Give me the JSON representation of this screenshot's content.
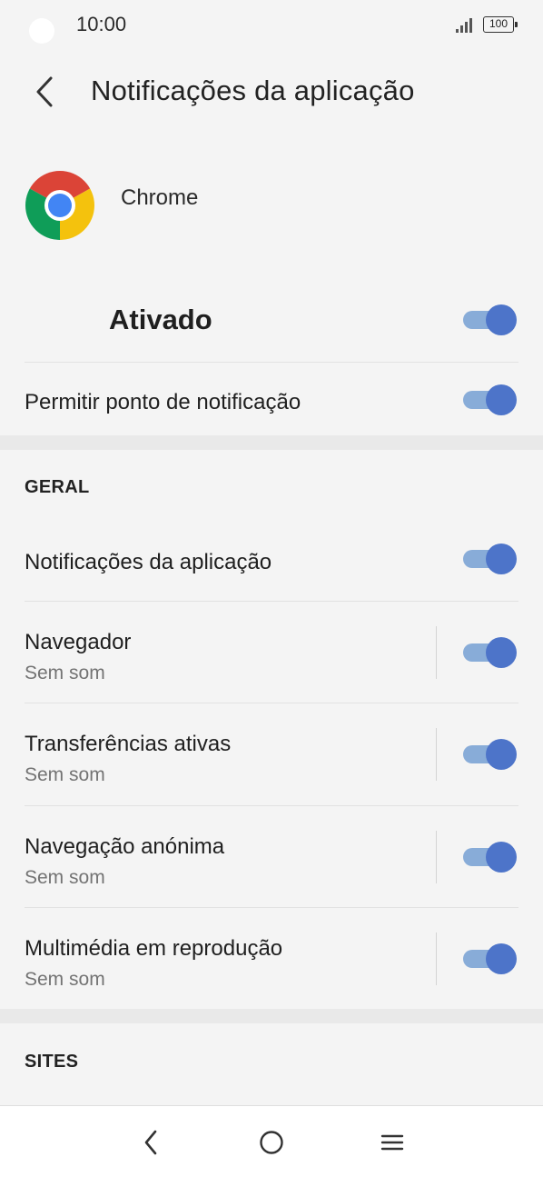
{
  "status_bar": {
    "time": "10:00",
    "battery": "100"
  },
  "header": {
    "title": "Notificações da aplicação",
    "back_icon": "chevron-left-icon"
  },
  "app": {
    "name": "Chrome",
    "icon": "chrome-logo-icon"
  },
  "master": {
    "label": "Ativado",
    "enabled": true
  },
  "badge_row": {
    "label": "Permitir ponto de notificação",
    "enabled": true
  },
  "sections": {
    "general": {
      "header": "GERAL",
      "items": [
        {
          "title": "Notificações da aplicação",
          "enabled": true
        },
        {
          "title": "Navegador",
          "subtitle": "Sem som",
          "enabled": true
        },
        {
          "title": "Transferências ativas",
          "subtitle": "Sem som",
          "enabled": true
        },
        {
          "title": "Navegação anónima",
          "subtitle": "Sem som",
          "enabled": true
        },
        {
          "title": "Multimédia em reprodução",
          "subtitle": "Sem som",
          "enabled": true
        }
      ]
    },
    "sites": {
      "header": "SITES"
    }
  },
  "colors": {
    "toggle_track": "#88acd8",
    "toggle_thumb": "#4d74c9",
    "background": "#f4f4f4"
  },
  "nav_bar": {
    "back": "back-icon",
    "home": "home-icon",
    "recents": "menu-icon"
  }
}
